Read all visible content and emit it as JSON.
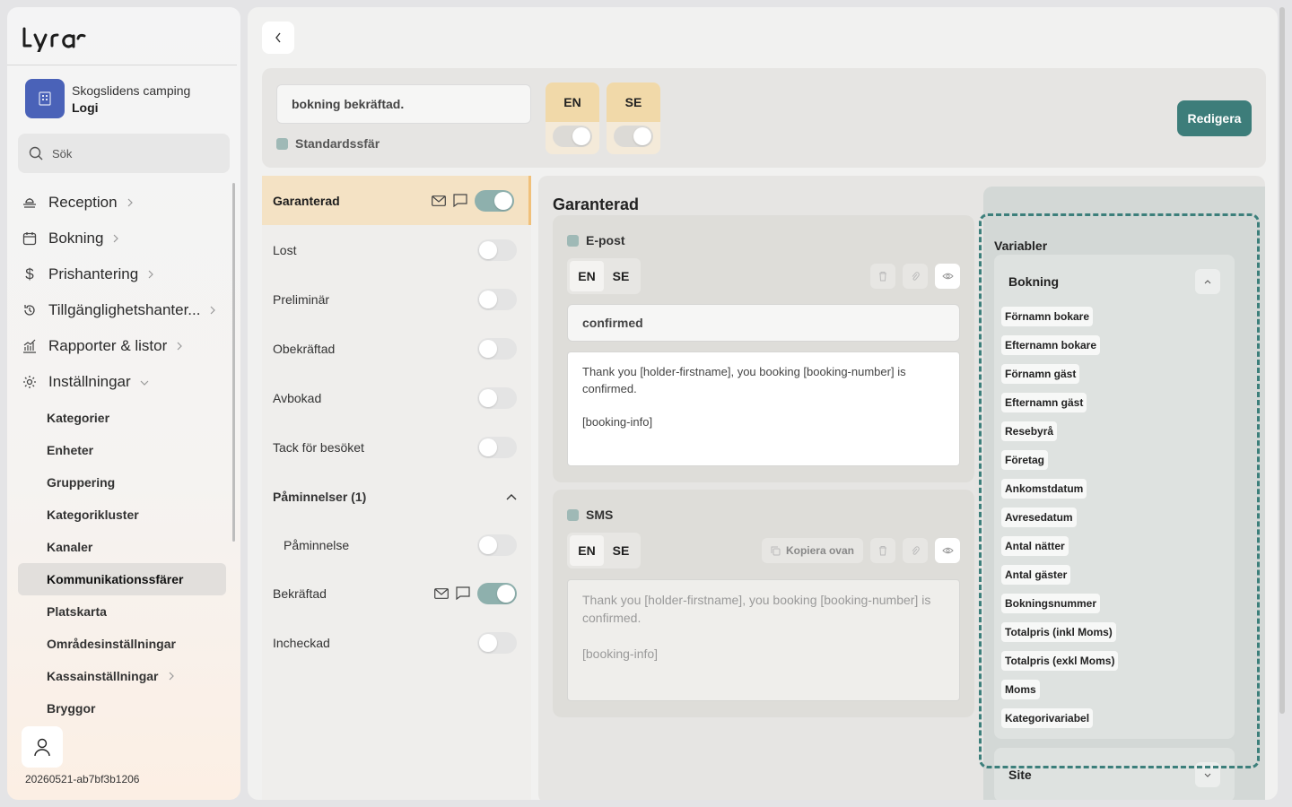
{
  "app": {
    "logo_text": "Lyra",
    "build_id": "20260521-ab7bf3b1206"
  },
  "org": {
    "name": "Skogslidens camping",
    "unit": "Logi"
  },
  "search": {
    "placeholder": "Sök"
  },
  "nav": [
    {
      "label": "Reception",
      "icon": "reception-icon"
    },
    {
      "label": "Bokning",
      "icon": "calendar-icon"
    },
    {
      "label": "Prishantering",
      "icon": "dollar-icon"
    },
    {
      "label": "Tillgänglighetshanter...",
      "icon": "history-icon"
    },
    {
      "label": "Rapporter & listor",
      "icon": "chart-icon"
    },
    {
      "label": "Inställningar",
      "icon": "gear-icon"
    }
  ],
  "subnav": [
    {
      "label": "Kategorier"
    },
    {
      "label": "Enheter"
    },
    {
      "label": "Gruppering"
    },
    {
      "label": "Kategorikluster"
    },
    {
      "label": "Kanaler"
    },
    {
      "label": "Kommunikationssfärer"
    },
    {
      "label": "Platskarta"
    },
    {
      "label": "Områdesinställningar"
    },
    {
      "label": "Kassainställningar"
    },
    {
      "label": "Bryggor"
    }
  ],
  "top": {
    "flow_name": "bokning bekräftad.",
    "default_label": "Standardssfär",
    "lang_en": "EN",
    "lang_se": "SE",
    "edit_label": "Redigera"
  },
  "statuses": [
    {
      "label": "Garanterad"
    },
    {
      "label": "Lost"
    },
    {
      "label": "Preliminär"
    },
    {
      "label": "Obekräftad"
    },
    {
      "label": "Avbokad"
    },
    {
      "label": "Tack för besöket"
    },
    {
      "label": "Påminnelser (1)"
    },
    {
      "label": "Påminnelse"
    },
    {
      "label": "Bekräftad"
    },
    {
      "label": "Incheckad"
    }
  ],
  "editor": {
    "title": "Garanterad",
    "email": {
      "label": "E-post",
      "tab_en": "EN",
      "tab_se": "SE",
      "subject": "confirmed",
      "body_line1": "Thank you [holder-firstname], you booking [booking-number] is confirmed.",
      "body_line2": "[booking-info]"
    },
    "sms": {
      "label": "SMS",
      "tab_en": "EN",
      "tab_se": "SE",
      "copy_label": "Kopiera ovan",
      "body_line1": "Thank you [holder-firstname], you booking [booking-number] is confirmed.",
      "body_line2": "[booking-info]"
    }
  },
  "variables": {
    "title": "Variabler",
    "group1": "Bokning",
    "group2": "Site",
    "items": [
      "Förnamn bokare",
      "Efternamn bokare",
      "Förnamn gäst",
      "Efternamn gäst",
      "Resebyrå",
      "Företag",
      "Ankomstdatum",
      "Avresedatum",
      "Antal nätter",
      "Antal gäster",
      "Bokningsnummer",
      "Totalpris (inkl Moms)",
      "Totalpris (exkl Moms)",
      "Moms",
      "Kategorivariabel"
    ]
  }
}
